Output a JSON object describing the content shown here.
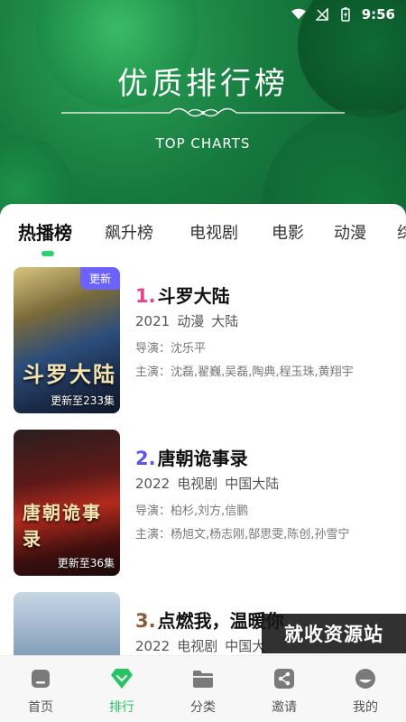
{
  "status_bar": {
    "time": "9:56"
  },
  "header": {
    "title": "优质排行榜",
    "subtitle": "TOP CHARTS"
  },
  "tabs": [
    "热播榜",
    "飙升榜",
    "电视剧",
    "电影",
    "动漫",
    "综"
  ],
  "active_tab": 0,
  "items": [
    {
      "rank": "1.",
      "title": "斗罗大陆",
      "year": "2021",
      "genre": "动漫",
      "region": "大陆",
      "director": "导演：沈乐平",
      "cast": "主演：沈磊,翟巍,吴磊,陶典,程玉珠,黄翔宇",
      "badge": "更新",
      "update": "更新至233集",
      "poster_text": "斗罗大陆",
      "rank_color": "#e8408a"
    },
    {
      "rank": "2.",
      "title": "唐朝诡事录",
      "year": "2022",
      "genre": "电视剧",
      "region": "中国大陆",
      "director": "导演：柏杉,刘方,信鹏",
      "cast": "主演：杨旭文,杨志刚,郜思雯,陈创,孙雪宁",
      "update": "更新至36集",
      "poster_text": "唐朝诡事录",
      "rank_color": "#5b57e8"
    },
    {
      "rank": "3.",
      "title": "点燃我，温暖你",
      "year": "2022",
      "genre": "电视剧",
      "region": "中国大",
      "rank_color": "#8a5a3c"
    }
  ],
  "watermark": "就收资源站",
  "nav": [
    {
      "label": "首页",
      "icon": "home-icon"
    },
    {
      "label": "排行",
      "icon": "ranking-diamond-icon"
    },
    {
      "label": "分类",
      "icon": "folder-icon"
    },
    {
      "label": "邀请",
      "icon": "share-icon"
    },
    {
      "label": "我的",
      "icon": "profile-icon"
    }
  ],
  "colors": {
    "accent": "#27c465",
    "header_green": "#167a3e",
    "badge_purple": "#6c63ff"
  }
}
